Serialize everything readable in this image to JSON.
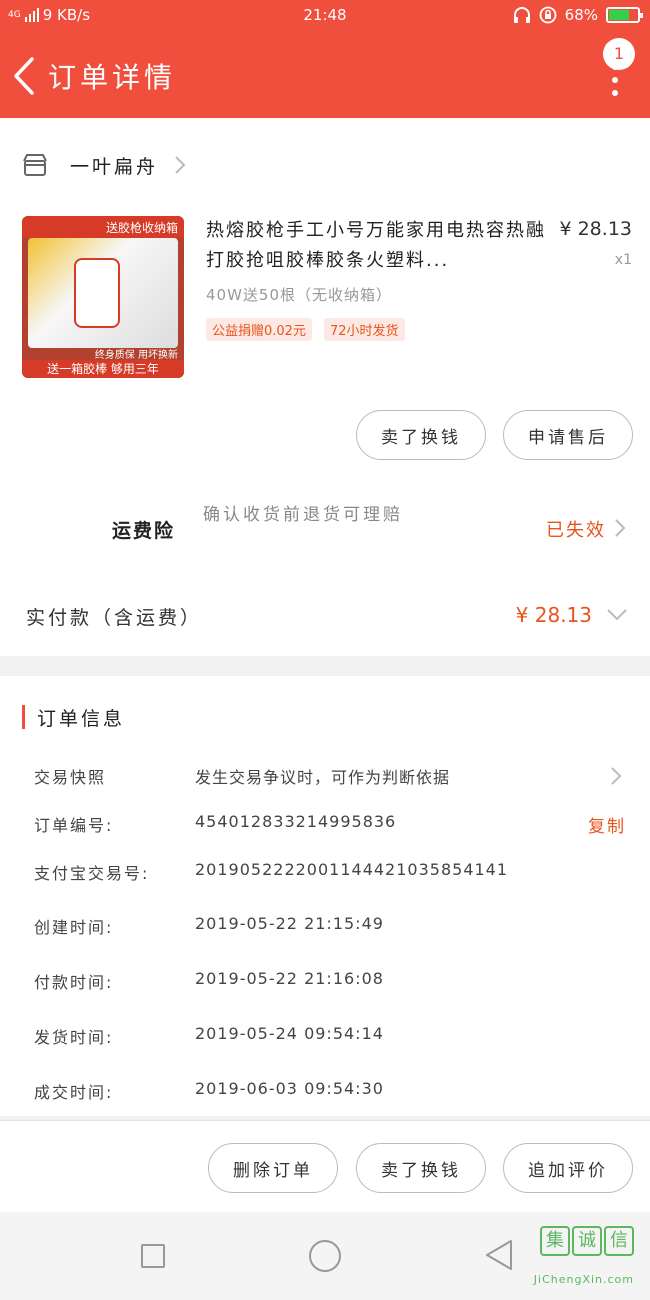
{
  "status_bar": {
    "network_type": "4G",
    "speed": "9 KB/s",
    "time": "21:48",
    "battery_percent": "68%",
    "battery_level": 0.68
  },
  "header": {
    "title": "订单详情",
    "badge_count": "1"
  },
  "shop": {
    "name": "一叶扁舟"
  },
  "product": {
    "title": "热熔胶枪手工小号万能家用电热容热融打胶抢咀胶棒胶条火塑料...",
    "price": "¥ 28.13",
    "quantity": "x1",
    "sku": "40W送50根（无收纳箱）",
    "tags": [
      "公益捐赠0.02元",
      "72小时发货"
    ],
    "image_text": {
      "top": "送胶枪收纳箱",
      "middle": "终身质保  用坏换新",
      "bottom": "送一箱胶棒  够用三年"
    }
  },
  "item_actions": {
    "sell_label": "卖了换钱",
    "after_sale_label": "申请售后"
  },
  "insurance": {
    "label": "运费险",
    "description": "确认收货前退货可理赔",
    "status": "已失效"
  },
  "payment": {
    "label": "实付款（含运费）",
    "amount": "¥ 28.13"
  },
  "order_info": {
    "title": "订单信息",
    "rows": [
      {
        "key": "交易快照",
        "value": "发生交易争议时，可作为判断依据"
      },
      {
        "key": "订单编号:",
        "value": "454012833214995836",
        "action": "复制"
      },
      {
        "key": "支付宝交易号:",
        "value": "2019052222001144421035854141"
      },
      {
        "key": "创建时间:",
        "value": "2019-05-22  21:15:49"
      },
      {
        "key": "付款时间:",
        "value": "2019-05-22  21:16:08"
      },
      {
        "key": "发货时间:",
        "value": "2019-05-24  09:54:14"
      },
      {
        "key": "成交时间:",
        "value": "2019-06-03  09:54:30"
      }
    ]
  },
  "bottom_actions": {
    "delete_label": "删除订单",
    "sell_label": "卖了换钱",
    "review_label": "追加评价"
  },
  "watermark": {
    "chars": [
      "集",
      "诚",
      "信"
    ],
    "text": "JiChengXin.com"
  },
  "colors": {
    "brand_red": "#f04f3e",
    "accent_orange": "#e8541e"
  }
}
